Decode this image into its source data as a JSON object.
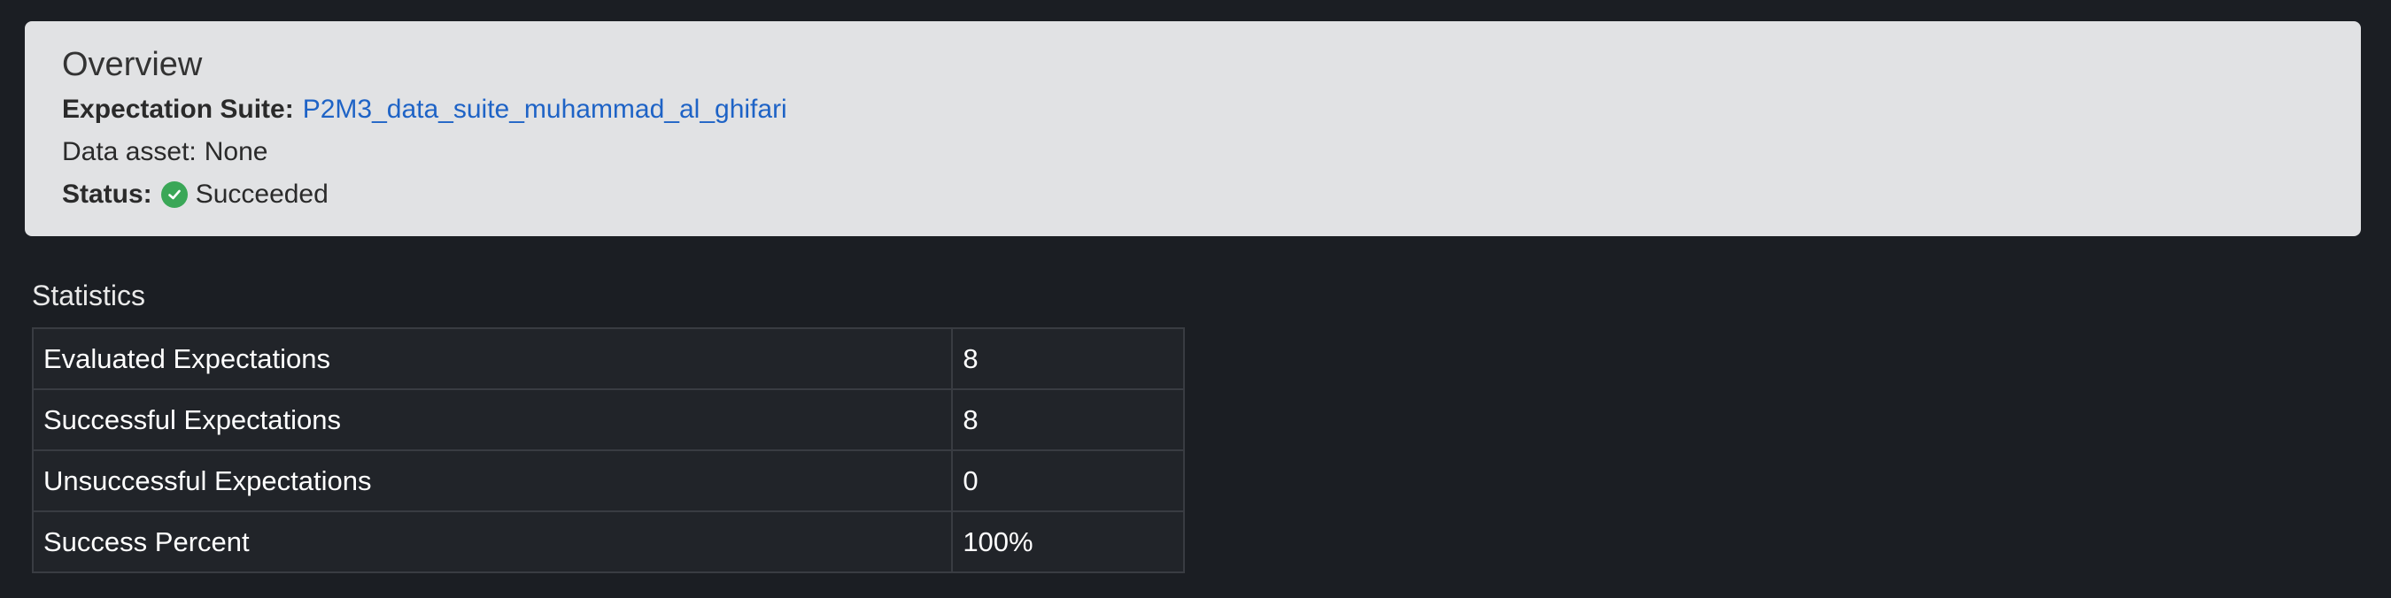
{
  "overview": {
    "title": "Overview",
    "expectation_suite_label": "Expectation Suite:",
    "expectation_suite_value": "P2M3_data_suite_muhammad_al_ghifari",
    "data_asset_label": "Data asset:",
    "data_asset_value": "None",
    "status_label": "Status:",
    "status_value": "Succeeded",
    "status_icon": "check-circle-icon",
    "status_color": "#3aa757",
    "link_color": "#1e63c6"
  },
  "statistics": {
    "heading": "Statistics",
    "rows": [
      {
        "label": "Evaluated Expectations",
        "value": "8"
      },
      {
        "label": "Successful Expectations",
        "value": "8"
      },
      {
        "label": "Unsuccessful Expectations",
        "value": "0"
      },
      {
        "label": "Success Percent",
        "value": "100%"
      }
    ]
  }
}
